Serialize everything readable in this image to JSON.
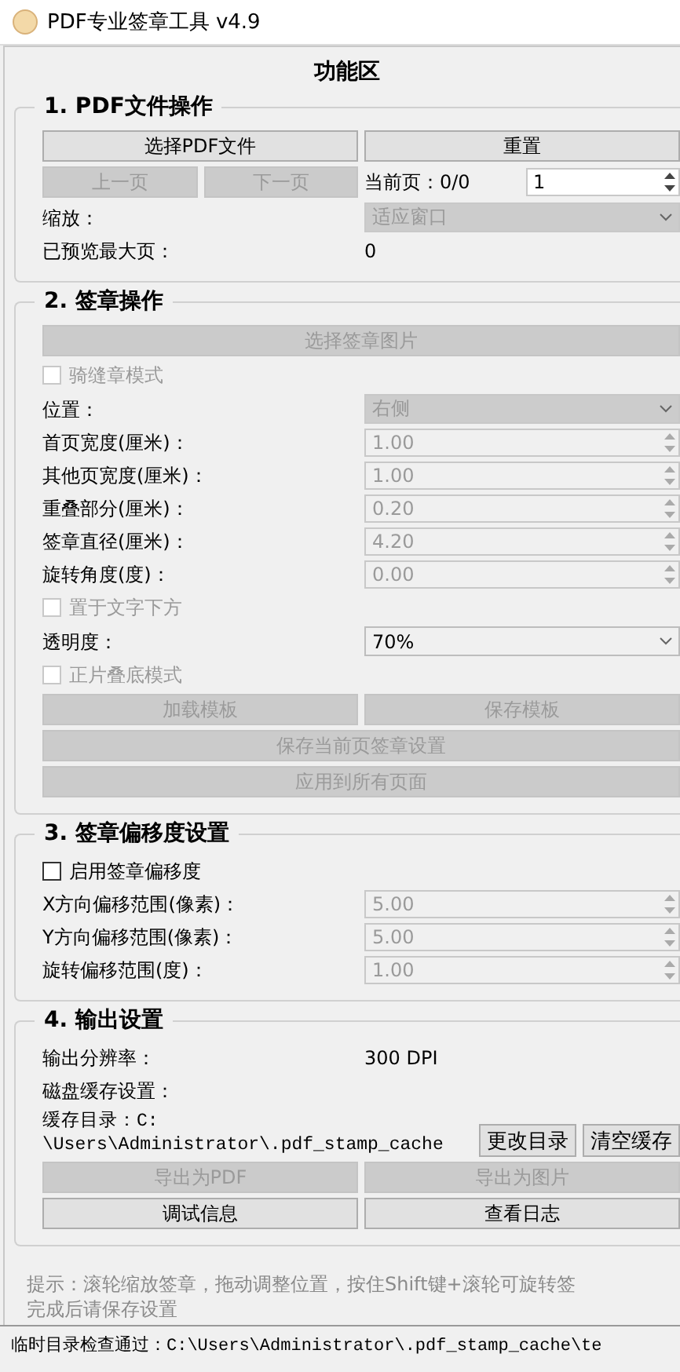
{
  "window": {
    "title": "PDF专业签章工具 v4.9"
  },
  "panel_title": "功能区",
  "sections": [
    {
      "title": "1. PDF文件操作",
      "rows": [
        {
          "kind": "buttons",
          "items": [
            {
              "label": "选择PDF文件",
              "disabled": false
            },
            {
              "label": "重置",
              "disabled": false
            }
          ]
        },
        {
          "kind": "pager",
          "items": [
            {
              "label": "上一页",
              "disabled": true
            },
            {
              "label": "下一页",
              "disabled": true
            }
          ],
          "label": "当前页：0/0",
          "control": {
            "kind": "spin",
            "value": "1",
            "disabled": false
          }
        },
        {
          "kind": "field",
          "label": "缩放：",
          "control": {
            "kind": "combo",
            "value": "适应窗口",
            "disabled": true
          }
        },
        {
          "kind": "field",
          "label": "已预览最大页：",
          "control": {
            "kind": "text",
            "value": "0"
          }
        }
      ]
    },
    {
      "title": "2. 签章操作",
      "rows": [
        {
          "kind": "buttons",
          "items": [
            {
              "label": "选择签章图片",
              "disabled": true
            }
          ]
        },
        {
          "kind": "check",
          "label": "骑缝章模式",
          "checked": false,
          "disabled": true
        },
        {
          "kind": "field",
          "label": "位置：",
          "control": {
            "kind": "combo",
            "value": "右侧",
            "disabled": true
          }
        },
        {
          "kind": "field",
          "label": "首页宽度(厘米)：",
          "control": {
            "kind": "spin",
            "value": "1.00",
            "disabled": true
          }
        },
        {
          "kind": "field",
          "label": "其他页宽度(厘米)：",
          "control": {
            "kind": "spin",
            "value": "1.00",
            "disabled": true
          }
        },
        {
          "kind": "field",
          "label": "重叠部分(厘米)：",
          "control": {
            "kind": "spin",
            "value": "0.20",
            "disabled": true
          }
        },
        {
          "kind": "field",
          "label": "签章直径(厘米)：",
          "control": {
            "kind": "spin",
            "value": "4.20",
            "disabled": true
          }
        },
        {
          "kind": "field",
          "label": "旋转角度(度)：",
          "control": {
            "kind": "spin",
            "value": "0.00",
            "disabled": true
          }
        },
        {
          "kind": "check",
          "label": "置于文字下方",
          "checked": false,
          "disabled": true
        },
        {
          "kind": "field",
          "label": "透明度：",
          "control": {
            "kind": "combo",
            "value": "70%",
            "disabled": false
          }
        },
        {
          "kind": "check",
          "label": "正片叠底模式",
          "checked": false,
          "disabled": true
        },
        {
          "kind": "buttons",
          "items": [
            {
              "label": "加载模板",
              "disabled": true
            },
            {
              "label": "保存模板",
              "disabled": true
            }
          ]
        },
        {
          "kind": "buttons",
          "items": [
            {
              "label": "保存当前页签章设置",
              "disabled": true
            }
          ]
        },
        {
          "kind": "buttons",
          "items": [
            {
              "label": "应用到所有页面",
              "disabled": true
            }
          ]
        }
      ]
    },
    {
      "title": "3. 签章偏移度设置",
      "rows": [
        {
          "kind": "check",
          "label": "启用签章偏移度",
          "checked": false,
          "disabled": false
        },
        {
          "kind": "field",
          "label": "X方向偏移范围(像素)：",
          "control": {
            "kind": "spin",
            "value": "5.00",
            "disabled": true
          }
        },
        {
          "kind": "field",
          "label": "Y方向偏移范围(像素)：",
          "control": {
            "kind": "spin",
            "value": "5.00",
            "disabled": true
          }
        },
        {
          "kind": "field",
          "label": "旋转偏移范围(度)：",
          "control": {
            "kind": "spin",
            "value": "1.00",
            "disabled": true
          }
        }
      ]
    },
    {
      "title": "4. 输出设置",
      "rows": [
        {
          "kind": "field",
          "label": "输出分辨率：",
          "control": {
            "kind": "text",
            "value": "300 DPI"
          }
        },
        {
          "kind": "note",
          "label": "磁盘缓存设置："
        },
        {
          "kind": "path",
          "lines": [
            "缓存目录：C:",
            "\\Users\\Administrator\\.pdf_stamp_cache"
          ],
          "items": [
            {
              "label": "更改目录",
              "disabled": false
            },
            {
              "label": "清空缓存",
              "disabled": false
            }
          ]
        },
        {
          "kind": "buttons",
          "items": [
            {
              "label": "导出为PDF",
              "disabled": true
            },
            {
              "label": "导出为图片",
              "disabled": true
            }
          ]
        },
        {
          "kind": "buttons",
          "items": [
            {
              "label": "调试信息",
              "disabled": false
            },
            {
              "label": "查看日志",
              "disabled": false
            }
          ]
        }
      ]
    }
  ],
  "hint_lines": [
    "提示：滚轮缩放签章，拖动调整位置，按住Shift键+滚轮可旋转签",
    "完成后请保存设置"
  ],
  "status_bar": "临时目录检查通过：C:\\Users\\Administrator\\.pdf_stamp_cache\\te"
}
